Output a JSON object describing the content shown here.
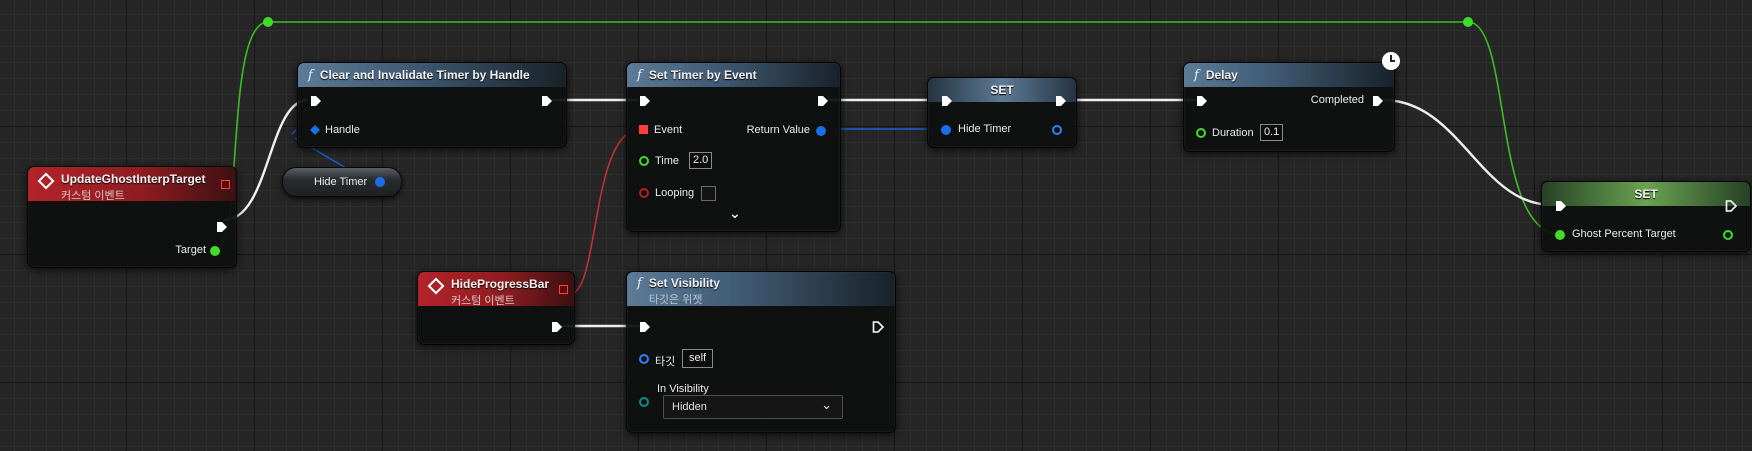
{
  "nodes": {
    "update_event": {
      "title": "UpdateGhostInterpTarget",
      "subtitle": "커스텀 이벤트",
      "target_label": "Target"
    },
    "clear_timer": {
      "title": "Clear and Invalidate Timer by Handle",
      "handle_label": "Handle"
    },
    "hide_timer_get": {
      "label": "Hide Timer"
    },
    "set_timer": {
      "title": "Set Timer by Event",
      "event_label": "Event",
      "return_label": "Return Value",
      "time_label": "Time",
      "time_value": "2.0",
      "looping_label": "Looping",
      "expand_glyph": "⌄"
    },
    "set_hide_timer": {
      "title": "SET",
      "var_label": "Hide Timer"
    },
    "delay": {
      "title": "Delay",
      "completed_label": "Completed",
      "duration_label": "Duration",
      "duration_value": "0.1"
    },
    "set_ghost": {
      "title": "SET",
      "var_label": "Ghost Percent Target"
    },
    "hide_event": {
      "title": "HideProgressBar",
      "subtitle": "커스텀 이벤트"
    },
    "set_visibility": {
      "title": "Set Visibility",
      "subtitle": "타깃은 위젯",
      "target_label": "타깃",
      "target_value": "self",
      "vis_label": "In Visibility",
      "vis_value": "Hidden",
      "chevron": "⌄"
    }
  },
  "icons": {
    "function": "function-icon",
    "event": "event-diamond-icon",
    "clock": "latent-clock-icon"
  },
  "colors": {
    "exec": "#ffffff",
    "float_pin": "#3fdc29",
    "handle_pin": "#1a6ee8",
    "delegate_pin": "#ff3b3b",
    "visibility_pin": "#0c8f85",
    "function_header": "#4a6a88",
    "event_header": "#a21f24"
  }
}
